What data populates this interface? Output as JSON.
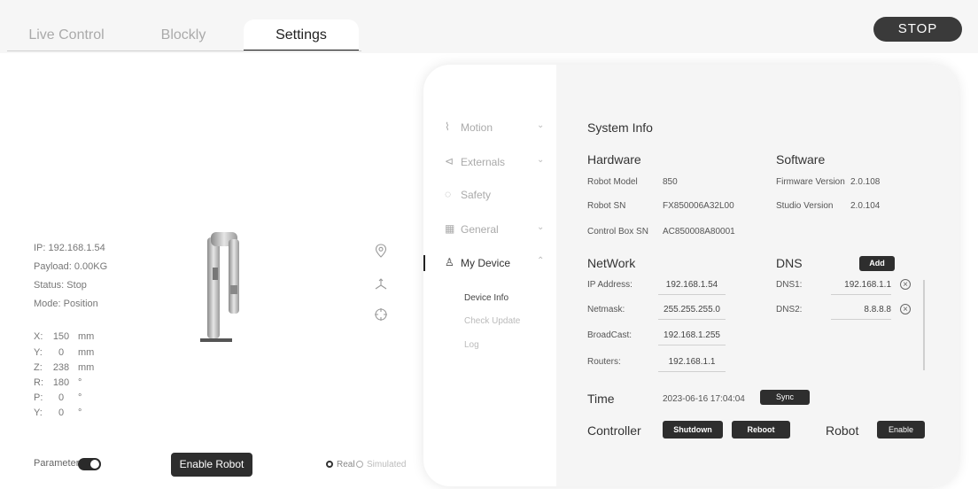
{
  "tabs": [
    {
      "label": "Live Control"
    },
    {
      "label": "Blockly"
    },
    {
      "label": "Settings"
    }
  ],
  "stop_label": "STOP",
  "robot_info": {
    "ip": "IP: 192.168.1.54",
    "payload": "Payload: 0.00KG",
    "status": "Status: Stop",
    "mode": "Mode: Position"
  },
  "coords": [
    {
      "axis": "X:",
      "value": "150",
      "unit": "mm"
    },
    {
      "axis": "Y:",
      "value": "0",
      "unit": "mm"
    },
    {
      "axis": "Z:",
      "value": "238",
      "unit": "mm"
    },
    {
      "axis": "R:",
      "value": "180",
      "unit": "°"
    },
    {
      "axis": "P:",
      "value": "0",
      "unit": "°"
    },
    {
      "axis": "Y:",
      "value": "0",
      "unit": "°"
    }
  ],
  "bottom": {
    "parameters_label": "Parameters",
    "enable_robot_label": "Enable Robot",
    "real_label": "Real",
    "simulated_label": "Simulated"
  },
  "nav": {
    "items": [
      {
        "label": "Motion"
      },
      {
        "label": "Externals"
      },
      {
        "label": "Safety"
      },
      {
        "label": "General"
      },
      {
        "label": "My Device"
      }
    ],
    "sub_items": [
      {
        "label": "Device Info"
      },
      {
        "label": "Check Update"
      },
      {
        "label": "Log"
      }
    ]
  },
  "system_info": {
    "title": "System Info",
    "hardware": {
      "title": "Hardware",
      "robot_model_label": "Robot Model",
      "robot_model": "850",
      "robot_sn_label": "Robot SN",
      "robot_sn": "FX850006A32L00",
      "control_box_sn_label": "Control Box SN",
      "control_box_sn": "AC850008A80001"
    },
    "software": {
      "title": "Software",
      "firmware_label": "Firmware Version",
      "firmware": "2.0.108",
      "studio_label": "Studio Version",
      "studio": "2.0.104"
    },
    "network": {
      "title": "NetWork",
      "ip_label": "IP Address:",
      "ip": "192.168.1.54",
      "netmask_label": "Netmask:",
      "netmask": "255.255.255.0",
      "broadcast_label": "BroadCast:",
      "broadcast": "192.168.1.255",
      "routers_label": "Routers:",
      "routers": "192.168.1.1"
    },
    "dns": {
      "title": "DNS",
      "add_label": "Add",
      "dns1_label": "DNS1:",
      "dns1": "192.168.1.1",
      "dns2_label": "DNS2:",
      "dns2": "8.8.8.8"
    },
    "time": {
      "title": "Time",
      "value": "2023-06-16 17:04:04",
      "sync_label": "Sync"
    },
    "controller": {
      "title": "Controller",
      "shutdown_label": "Shutdown",
      "reboot_label": "Reboot"
    },
    "robot": {
      "title": "Robot",
      "enable_label": "Enable"
    }
  }
}
